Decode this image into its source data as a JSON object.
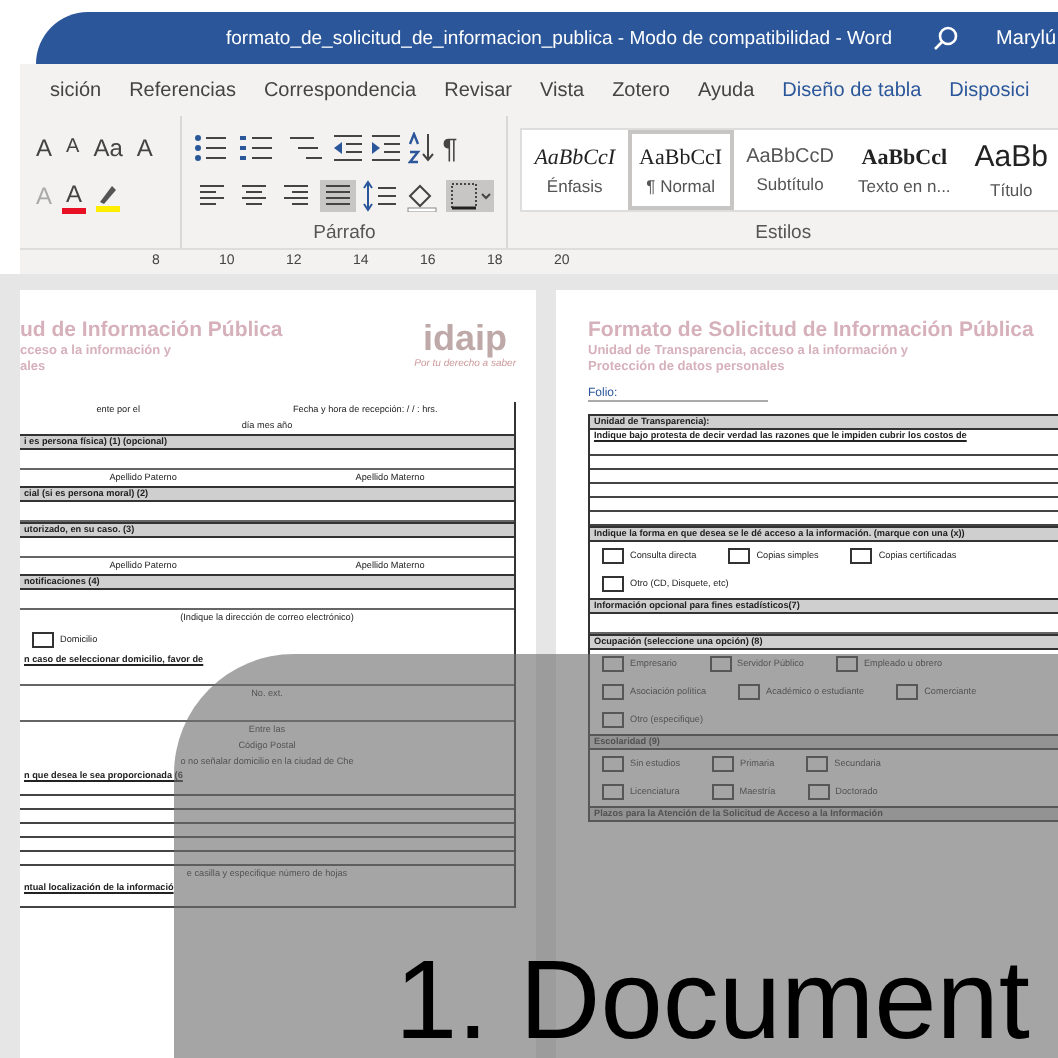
{
  "window": {
    "title": "formato_de_solicitud_de_informacion_publica  -  Modo de compatibilidad  -  Word",
    "user": "Marylú"
  },
  "ribbon_tabs": [
    {
      "label": "sición",
      "contextual": false
    },
    {
      "label": "Referencias",
      "contextual": false
    },
    {
      "label": "Correspondencia",
      "contextual": false
    },
    {
      "label": "Revisar",
      "contextual": false
    },
    {
      "label": "Vista",
      "contextual": false
    },
    {
      "label": "Zotero",
      "contextual": false
    },
    {
      "label": "Ayuda",
      "contextual": false
    },
    {
      "label": "Diseño de tabla",
      "contextual": true
    },
    {
      "label": "Disposici",
      "contextual": true
    }
  ],
  "font_tools": [
    {
      "label": "A",
      "kind": "grow"
    },
    {
      "label": "A",
      "kind": "shrink"
    },
    {
      "label": "Aa",
      "kind": "case"
    },
    {
      "label": "A",
      "kind": "clear"
    }
  ],
  "font_tools_2": [
    {
      "label": "A",
      "kind": "effects"
    },
    {
      "label": "A",
      "kind": "color",
      "color": "#e81123"
    }
  ],
  "paragraph": {
    "label": "Párrafo",
    "pilcrow": "¶",
    "justify_active": true,
    "borders_active": true
  },
  "styles_group": {
    "label": "Estilos",
    "items": [
      {
        "preview": "AaBbCcI",
        "label": "Énfasis",
        "kind": "italic",
        "selected": false
      },
      {
        "preview": "AaBbCcI",
        "label": "¶ Normal",
        "kind": "serif",
        "selected": true
      },
      {
        "preview": "AaBbCcD",
        "label": "Subtítulo",
        "kind": "light",
        "selected": false
      },
      {
        "preview": "AaBbCcl",
        "label": "Texto en n...",
        "kind": "bold",
        "selected": false
      },
      {
        "preview": "AaBb",
        "label": "Título",
        "kind": "large",
        "selected": false
      }
    ]
  },
  "ruler": [
    "8",
    "10",
    "12",
    "14",
    "16",
    "18",
    "20"
  ],
  "left_page": {
    "title": "ud de Información Pública",
    "subtitle": [
      "cceso a la información y",
      "ales"
    ],
    "logo": "idaip",
    "tagline": "Por tu derecho a saber",
    "rows": [
      {
        "kind": "labels",
        "texts": [
          "ente por el",
          "Fecha y hora de recepción:   /     /          :   hrs."
        ]
      },
      {
        "kind": "labels",
        "texts": [
          "día   mes    año"
        ]
      },
      {
        "kind": "header",
        "texts": [
          "i es persona física) (1) (opcional)"
        ]
      },
      {
        "kind": "blank"
      },
      {
        "kind": "labels",
        "texts": [
          "Apellido Paterno",
          "Apellido Materno"
        ]
      },
      {
        "kind": "header",
        "texts": [
          "cial (si es persona moral) (2)"
        ]
      },
      {
        "kind": "blank"
      },
      {
        "kind": "header",
        "texts": [
          "utorizado, en su caso. (3)"
        ]
      },
      {
        "kind": "blank"
      },
      {
        "kind": "labels",
        "texts": [
          "Apellido Paterno",
          "Apellido Materno"
        ]
      },
      {
        "kind": "header",
        "texts": [
          "notificaciones (4)"
        ]
      },
      {
        "kind": "blank"
      },
      {
        "kind": "labels",
        "texts": [
          "(Indique la dirección de correo electrónico)"
        ]
      },
      {
        "kind": "checks",
        "options": [
          {
            "label": "Domicilio",
            "checked": false
          }
        ]
      },
      {
        "kind": "bold",
        "texts": [
          "n caso de seleccionar domicilio, favor de"
        ]
      },
      {
        "kind": "blank"
      },
      {
        "kind": "labels",
        "texts": [
          "No. ext."
        ]
      },
      {
        "kind": "blank"
      },
      {
        "kind": "labels",
        "texts": [
          "Entre las"
        ]
      },
      {
        "kind": "labels",
        "texts": [
          "Código Postal"
        ]
      },
      {
        "kind": "labels",
        "texts": [
          "o no señalar domicilio en la ciudad de Che"
        ]
      },
      {
        "kind": "bold",
        "texts": [
          "n que desea le sea proporcionada (6"
        ]
      },
      {
        "kind": "line"
      },
      {
        "kind": "line"
      },
      {
        "kind": "line"
      },
      {
        "kind": "line"
      },
      {
        "kind": "line"
      },
      {
        "kind": "line"
      },
      {
        "kind": "labels",
        "texts": [
          "e casilla y especifique número de hojas"
        ]
      },
      {
        "kind": "bold",
        "texts": [
          "ntual localización de la informació"
        ]
      },
      {
        "kind": "line"
      }
    ]
  },
  "right_page": {
    "title": "Formato de Solicitud de Información Pública",
    "subtitle": [
      "Unidad de Transparencia, acceso a la información y",
      "Protección de datos personales"
    ],
    "folio": "Folio:",
    "rows": [
      {
        "kind": "header",
        "texts": [
          "Unidad de Transparencia):"
        ]
      },
      {
        "kind": "bold",
        "texts": [
          "Indique bajo protesta de decir verdad las razones que le impiden cubrir los costos de"
        ]
      },
      {
        "kind": "line"
      },
      {
        "kind": "line"
      },
      {
        "kind": "line"
      },
      {
        "kind": "line"
      },
      {
        "kind": "line"
      },
      {
        "kind": "line"
      },
      {
        "kind": "header",
        "texts": [
          "Indique la forma en que desea se le dé acceso a la información. (marque con una (x))"
        ]
      },
      {
        "kind": "checks",
        "options": [
          {
            "label": "Consulta directa",
            "checked": false
          },
          {
            "label": "Copias simples",
            "checked": false
          },
          {
            "label": "Copias certificadas",
            "checked": false
          }
        ]
      },
      {
        "kind": "checks",
        "options": [
          {
            "label": "Otro (CD, Disquete, etc)",
            "checked": false
          }
        ]
      },
      {
        "kind": "header",
        "texts": [
          "Información opcional para fines estadísticos(7)"
        ]
      },
      {
        "kind": "blank"
      },
      {
        "kind": "header",
        "texts": [
          "Ocupación (seleccione una opción) (8)"
        ]
      },
      {
        "kind": "checks",
        "options": [
          {
            "label": "Empresario",
            "checked": false
          },
          {
            "label": "Servidor Público",
            "checked": false
          },
          {
            "label": "Empleado u obrero",
            "checked": false
          }
        ]
      },
      {
        "kind": "checks",
        "options": [
          {
            "label": "Asociación política",
            "checked": false
          },
          {
            "label": "Académico o estudiante",
            "checked": false
          },
          {
            "label": "Comerciante",
            "checked": false
          }
        ]
      },
      {
        "kind": "checks",
        "options": [
          {
            "label": "Otro (especifique)",
            "checked": false
          }
        ]
      },
      {
        "kind": "header",
        "texts": [
          "Escolaridad (9)"
        ]
      },
      {
        "kind": "checks",
        "options": [
          {
            "label": "Sin estudios",
            "checked": false
          },
          {
            "label": "Primaria",
            "checked": false
          },
          {
            "label": "Secundaria",
            "checked": false
          }
        ]
      },
      {
        "kind": "checks",
        "options": [
          {
            "label": "Licenciatura",
            "checked": false
          },
          {
            "label": "Maestría",
            "checked": false
          },
          {
            "label": "Doctorado",
            "checked": false
          }
        ]
      },
      {
        "kind": "header",
        "texts": [
          "Plazos para la Atención de la Solicitud de Acceso a la Información"
        ]
      }
    ]
  },
  "overlay": {
    "caption": "1. Document"
  }
}
